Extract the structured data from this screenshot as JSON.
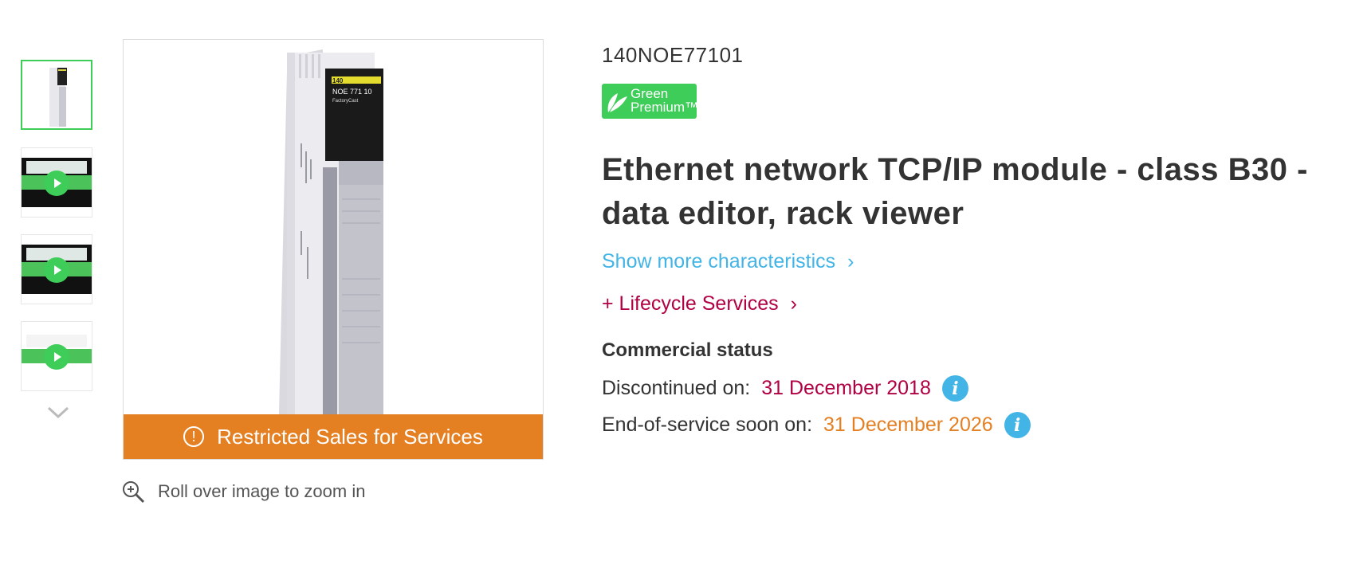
{
  "product": {
    "sku": "140NOE77101",
    "title": "Ethernet network TCP/IP module - class B30 - data editor, rack viewer",
    "badge": {
      "line1": "Green",
      "line2": "Premium™"
    }
  },
  "links": {
    "show_more": "Show more characteristics",
    "lifecycle": "+ Lifecycle Services",
    "chevron": "›"
  },
  "gallery": {
    "restricted_label": "Restricted Sales for Services",
    "warn_glyph": "!",
    "zoom_hint": "Roll over image to zoom in",
    "module_label_line1": "140",
    "module_label_line2": "NOE 771 10",
    "module_label_line3": "FactoryCast"
  },
  "commercial_status": {
    "heading": "Commercial status",
    "discontinued_label": "Discontinued on:",
    "discontinued_date": "31 December 2018",
    "eos_label": "End-of-service soon on:",
    "eos_date": "31 December 2026",
    "info_glyph": "i"
  },
  "colors": {
    "green": "#3dcd58",
    "orange": "#e47f22",
    "link_blue": "#42b4e6",
    "lifecycle_red": "#b10043"
  }
}
